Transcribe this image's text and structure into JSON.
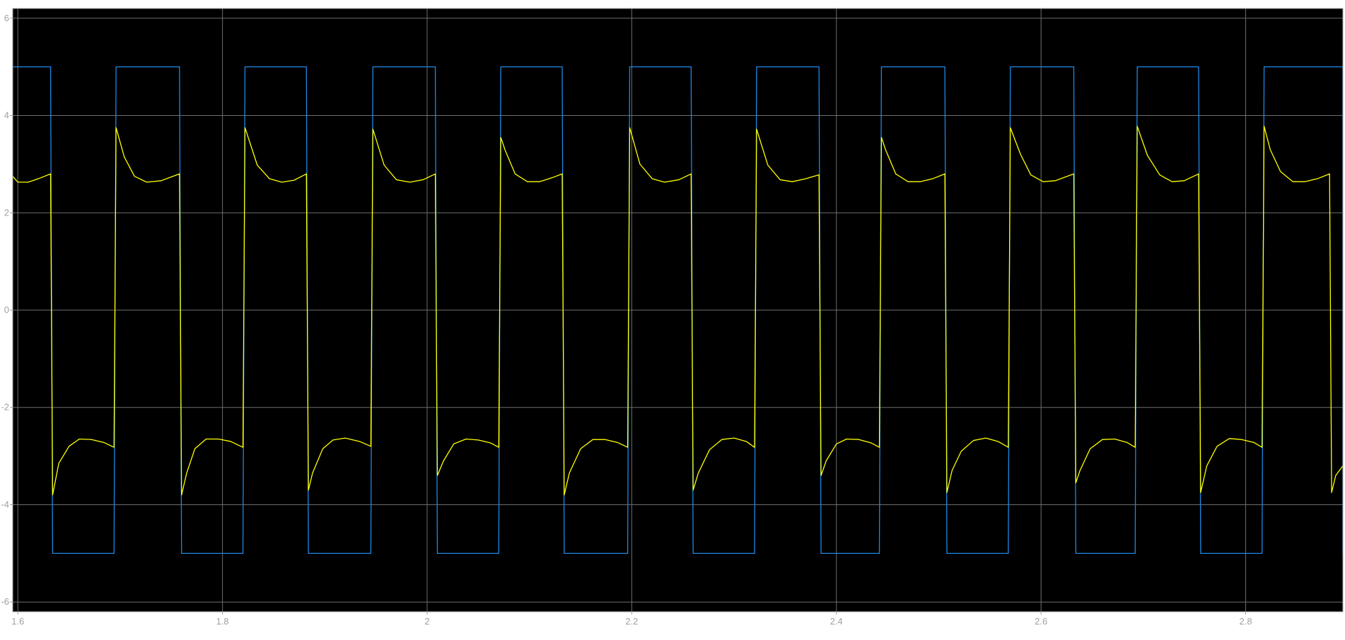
{
  "chart_data": {
    "type": "line",
    "title": "",
    "xlabel": "",
    "ylabel": "",
    "xlim": [
      1.595,
      2.895
    ],
    "ylim": [
      -6.2,
      6.2
    ],
    "grid": true,
    "background": "#000000",
    "grid_color": "#6e6e6e",
    "axes_border_color": "#a0a0a0",
    "x_ticks": [
      1.6,
      1.8,
      2.0,
      2.2,
      2.4,
      2.6,
      2.8
    ],
    "x_tick_labels": [
      "1.6",
      "1.8",
      "2",
      "2.2",
      "2.4",
      "2.6",
      "2.8"
    ],
    "y_ticks": [
      -6,
      -4,
      -2,
      0,
      2,
      4,
      6
    ],
    "y_tick_labels": [
      "-6",
      "-4",
      "-2",
      "0",
      "2",
      "4",
      "6"
    ],
    "series": [
      {
        "color": "#1e88e5",
        "points": [
          [
            1.595,
            5
          ],
          [
            1.632,
            5
          ],
          [
            1.634,
            -5
          ],
          [
            1.694,
            -5
          ],
          [
            1.696,
            5
          ],
          [
            1.758,
            5
          ],
          [
            1.76,
            -5
          ],
          [
            1.82,
            -5
          ],
          [
            1.822,
            5
          ],
          [
            1.882,
            5
          ],
          [
            1.884,
            -5
          ],
          [
            1.945,
            -5
          ],
          [
            1.947,
            5
          ],
          [
            2.008,
            5
          ],
          [
            2.01,
            -5
          ],
          [
            2.07,
            -5
          ],
          [
            2.072,
            5
          ],
          [
            2.132,
            5
          ],
          [
            2.134,
            -5
          ],
          [
            2.196,
            -5
          ],
          [
            2.198,
            5
          ],
          [
            2.258,
            5
          ],
          [
            2.26,
            -5
          ],
          [
            2.32,
            -5
          ],
          [
            2.322,
            5
          ],
          [
            2.383,
            5
          ],
          [
            2.385,
            -5
          ],
          [
            2.442,
            -5
          ],
          [
            2.444,
            5
          ],
          [
            2.506,
            5
          ],
          [
            2.508,
            -5
          ],
          [
            2.568,
            -5
          ],
          [
            2.57,
            5
          ],
          [
            2.632,
            5
          ],
          [
            2.634,
            -5
          ],
          [
            2.692,
            -5
          ],
          [
            2.694,
            5
          ],
          [
            2.754,
            5
          ],
          [
            2.756,
            -5
          ],
          [
            2.816,
            -5
          ],
          [
            2.818,
            5
          ],
          [
            2.895,
            5
          ],
          [
            2.895,
            -5
          ]
        ]
      },
      {
        "color": "#ffff00",
        "points": [
          [
            1.595,
            2.75
          ],
          [
            1.6,
            2.63
          ],
          [
            1.61,
            2.63
          ],
          [
            1.62,
            2.7
          ],
          [
            1.632,
            2.8
          ],
          [
            1.634,
            -3.8
          ],
          [
            1.64,
            -3.15
          ],
          [
            1.65,
            -2.8
          ],
          [
            1.66,
            -2.65
          ],
          [
            1.672,
            -2.66
          ],
          [
            1.684,
            -2.72
          ],
          [
            1.694,
            -2.82
          ],
          [
            1.696,
            3.75
          ],
          [
            1.704,
            3.15
          ],
          [
            1.714,
            2.75
          ],
          [
            1.726,
            2.63
          ],
          [
            1.74,
            2.66
          ],
          [
            1.758,
            2.8
          ],
          [
            1.76,
            -3.8
          ],
          [
            1.765,
            -3.35
          ],
          [
            1.773,
            -2.85
          ],
          [
            1.784,
            -2.65
          ],
          [
            1.796,
            -2.65
          ],
          [
            1.808,
            -2.7
          ],
          [
            1.82,
            -2.82
          ],
          [
            1.822,
            3.75
          ],
          [
            1.834,
            2.98
          ],
          [
            1.846,
            2.7
          ],
          [
            1.858,
            2.63
          ],
          [
            1.87,
            2.67
          ],
          [
            1.882,
            2.8
          ],
          [
            1.884,
            -3.7
          ],
          [
            1.888,
            -3.35
          ],
          [
            1.898,
            -2.85
          ],
          [
            1.908,
            -2.67
          ],
          [
            1.92,
            -2.63
          ],
          [
            1.934,
            -2.7
          ],
          [
            1.945,
            -2.8
          ],
          [
            1.947,
            3.72
          ],
          [
            1.958,
            2.98
          ],
          [
            1.97,
            2.68
          ],
          [
            1.983,
            2.63
          ],
          [
            1.996,
            2.68
          ],
          [
            2.008,
            2.8
          ],
          [
            2.01,
            -3.4
          ],
          [
            2.016,
            -3.1
          ],
          [
            2.026,
            -2.75
          ],
          [
            2.038,
            -2.65
          ],
          [
            2.05,
            -2.67
          ],
          [
            2.062,
            -2.73
          ],
          [
            2.07,
            -2.82
          ],
          [
            2.072,
            3.55
          ],
          [
            2.076,
            3.3
          ],
          [
            2.086,
            2.8
          ],
          [
            2.098,
            2.64
          ],
          [
            2.11,
            2.64
          ],
          [
            2.122,
            2.72
          ],
          [
            2.132,
            2.8
          ],
          [
            2.134,
            -3.8
          ],
          [
            2.139,
            -3.35
          ],
          [
            2.15,
            -2.85
          ],
          [
            2.162,
            -2.66
          ],
          [
            2.174,
            -2.66
          ],
          [
            2.186,
            -2.72
          ],
          [
            2.196,
            -2.82
          ],
          [
            2.198,
            3.75
          ],
          [
            2.208,
            3.0
          ],
          [
            2.22,
            2.7
          ],
          [
            2.232,
            2.63
          ],
          [
            2.246,
            2.68
          ],
          [
            2.258,
            2.8
          ],
          [
            2.26,
            -3.7
          ],
          [
            2.265,
            -3.35
          ],
          [
            2.276,
            -2.87
          ],
          [
            2.288,
            -2.66
          ],
          [
            2.3,
            -2.63
          ],
          [
            2.312,
            -2.7
          ],
          [
            2.32,
            -2.82
          ],
          [
            2.322,
            3.72
          ],
          [
            2.333,
            2.98
          ],
          [
            2.345,
            2.68
          ],
          [
            2.357,
            2.64
          ],
          [
            2.37,
            2.7
          ],
          [
            2.383,
            2.78
          ],
          [
            2.385,
            -3.4
          ],
          [
            2.39,
            -3.1
          ],
          [
            2.4,
            -2.75
          ],
          [
            2.41,
            -2.65
          ],
          [
            2.422,
            -2.66
          ],
          [
            2.434,
            -2.73
          ],
          [
            2.442,
            -2.82
          ],
          [
            2.444,
            3.55
          ],
          [
            2.448,
            3.3
          ],
          [
            2.458,
            2.8
          ],
          [
            2.47,
            2.64
          ],
          [
            2.482,
            2.64
          ],
          [
            2.494,
            2.7
          ],
          [
            2.506,
            2.8
          ],
          [
            2.508,
            -3.75
          ],
          [
            2.513,
            -3.3
          ],
          [
            2.522,
            -2.9
          ],
          [
            2.534,
            -2.68
          ],
          [
            2.546,
            -2.63
          ],
          [
            2.558,
            -2.7
          ],
          [
            2.568,
            -2.82
          ],
          [
            2.57,
            3.75
          ],
          [
            2.58,
            3.2
          ],
          [
            2.59,
            2.78
          ],
          [
            2.602,
            2.64
          ],
          [
            2.614,
            2.66
          ],
          [
            2.632,
            2.8
          ],
          [
            2.634,
            -3.55
          ],
          [
            2.638,
            -3.3
          ],
          [
            2.648,
            -2.85
          ],
          [
            2.66,
            -2.66
          ],
          [
            2.672,
            -2.65
          ],
          [
            2.684,
            -2.72
          ],
          [
            2.692,
            -2.82
          ],
          [
            2.694,
            3.78
          ],
          [
            2.704,
            3.18
          ],
          [
            2.716,
            2.78
          ],
          [
            2.728,
            2.64
          ],
          [
            2.74,
            2.66
          ],
          [
            2.754,
            2.8
          ],
          [
            2.756,
            -3.75
          ],
          [
            2.762,
            -3.2
          ],
          [
            2.772,
            -2.8
          ],
          [
            2.784,
            -2.64
          ],
          [
            2.796,
            -2.66
          ],
          [
            2.808,
            -2.72
          ],
          [
            2.816,
            -2.82
          ],
          [
            2.818,
            3.78
          ],
          [
            2.824,
            3.3
          ],
          [
            2.834,
            2.85
          ],
          [
            2.846,
            2.64
          ],
          [
            2.858,
            2.64
          ],
          [
            2.87,
            2.7
          ],
          [
            2.882,
            2.8
          ],
          [
            2.884,
            -3.75
          ],
          [
            2.888,
            -3.4
          ],
          [
            2.895,
            -3.2
          ]
        ]
      }
    ]
  }
}
